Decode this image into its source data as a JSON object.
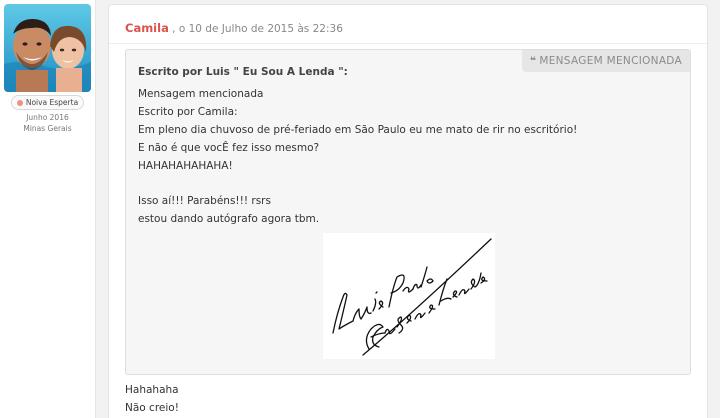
{
  "user": {
    "badge": "Noiva Esperta",
    "join_date": "Junho 2016",
    "location": "Minas Gerais",
    "colors": {
      "badge_dot": "#f0907e"
    }
  },
  "post": {
    "author": "Camila",
    "date": ", o 10 de Julho de 2015 às 22:36",
    "colors": {
      "author": "#d9534f"
    },
    "quote": {
      "tag_icon": "quote-icon",
      "tag_label": "MENSAGEM MENCIONADA",
      "author_line": "Escrito por Luis \" Eu Sou A Lenda \":",
      "lines": [
        "Mensagem mencionada",
        "Escrito por Camila:",
        "Em pleno dia chuvoso de pré-feriado em São Paulo eu me mato de rir no escritório!",
        "E não é que vocÊ fez isso mesmo?",
        "HAHAHAHAHAHA!",
        "Isso aí!!! Parabéns!!! rsrs",
        "estou dando autógrafo agora tbm."
      ],
      "signature_text": "Luis Paulo — Eu Sou a Lenda"
    },
    "reply_lines": [
      "Hahahaha",
      "Não creio!"
    ]
  }
}
